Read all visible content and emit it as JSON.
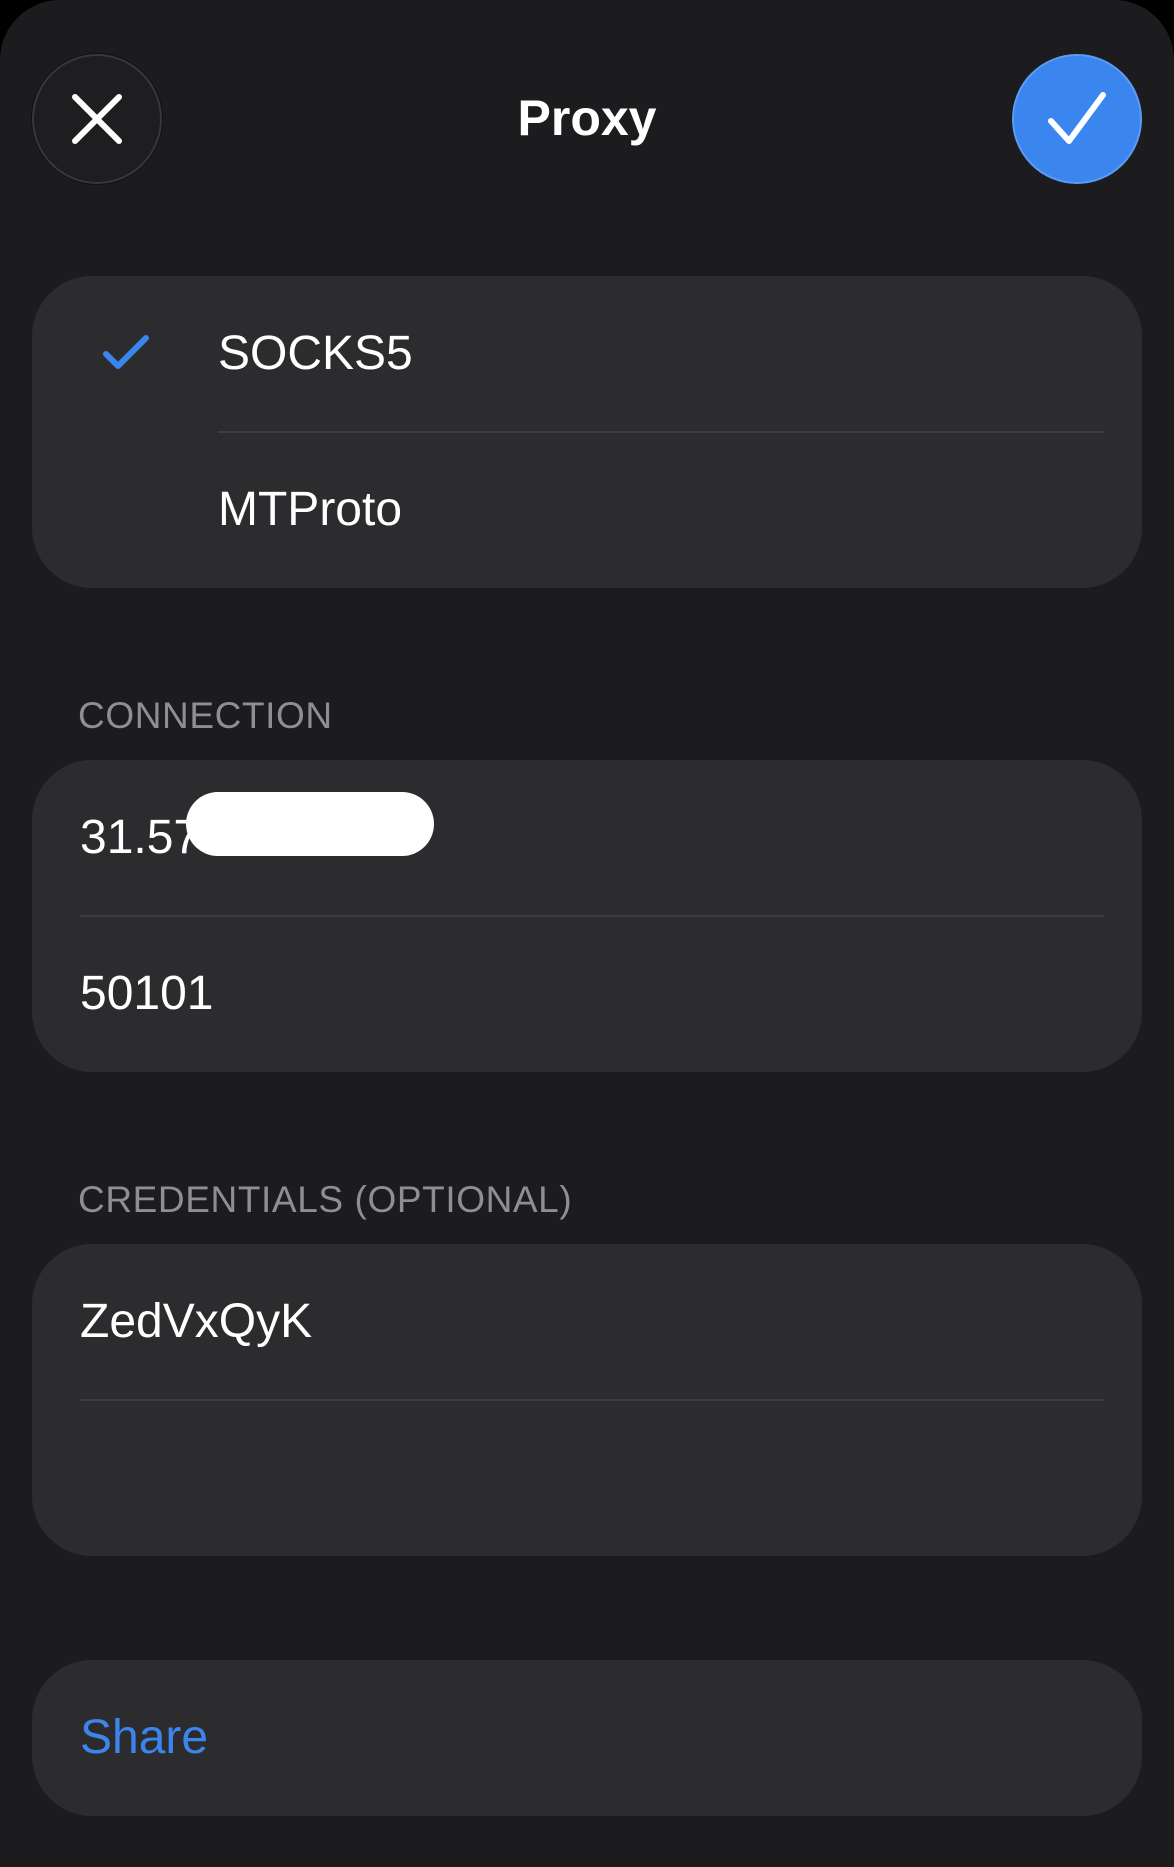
{
  "header": {
    "title": "Proxy",
    "close_icon": "close-icon",
    "done_icon": "checkmark-icon"
  },
  "type_options": [
    {
      "label": "SOCKS5",
      "selected": true
    },
    {
      "label": "MTProto",
      "selected": false
    }
  ],
  "connection": {
    "section_label": "CONNECTION",
    "server_value": "31.57.2",
    "port_value": "50101"
  },
  "credentials": {
    "section_label": "CREDENTIALS (OPTIONAL)",
    "username_value": "ZedVxQyK",
    "password_value": ""
  },
  "share": {
    "label": "Share"
  },
  "colors": {
    "background": "#1c1c1e",
    "card": "#2c2c2e",
    "accent": "#3a86ee",
    "secondary_text": "#8e8e93"
  }
}
